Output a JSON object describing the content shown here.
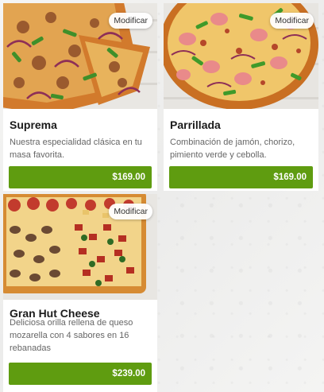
{
  "products": [
    {
      "name": "Suprema",
      "description": "Nuestra especialidad clásica en tu masa favorita.",
      "price": "$169.00",
      "modify_label": "Modificar",
      "image_icon": "pizza-suprema-photo"
    },
    {
      "name": "Parrillada",
      "description": "Combinación de jamón, chorizo, pimiento verde y cebolla.",
      "price": "$169.00",
      "modify_label": "Modificar",
      "image_icon": "pizza-parrillada-photo"
    },
    {
      "name": "Gran Hut Cheese",
      "description": "Deliciosa orilla rellena de queso mozarella con 4 sabores en 16 rebanadas",
      "price": "$239.00",
      "modify_label": "Modificar",
      "image_icon": "pizza-gran-hut-cheese-photo"
    }
  ],
  "colors": {
    "price_button": "#5f9c10",
    "card_background": "#ffffff",
    "page_background": "#f2f2f1"
  }
}
